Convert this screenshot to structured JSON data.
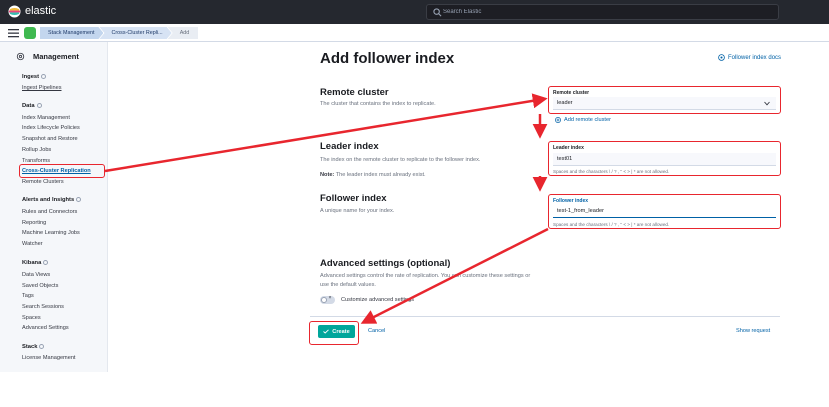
{
  "header": {
    "brand": "elastic",
    "search_placeholder": "Search Elastic"
  },
  "breadcrumbs": [
    "Stack Management",
    "Cross-Cluster Repli...",
    "Add"
  ],
  "sidebar": {
    "title": "Management",
    "groups": [
      {
        "label": "Ingest",
        "items": [
          "Ingest Pipelines"
        ]
      },
      {
        "label": "Data",
        "items": [
          "Index Management",
          "Index Lifecycle Policies",
          "Snapshot and Restore",
          "Rollup Jobs",
          "Transforms",
          "Cross-Cluster Replication",
          "Remote Clusters"
        ]
      },
      {
        "label": "Alerts and Insights",
        "items": [
          "Rules and Connectors",
          "Reporting",
          "Machine Learning Jobs",
          "Watcher"
        ]
      },
      {
        "label": "Kibana",
        "items": [
          "Data Views",
          "Saved Objects",
          "Tags",
          "Search Sessions",
          "Spaces",
          "Advanced Settings"
        ]
      },
      {
        "label": "Stack",
        "items": [
          "License Management"
        ]
      }
    ],
    "active_item": "Cross-Cluster Replication"
  },
  "main": {
    "title": "Add follower index",
    "docs_link": "Follower index docs",
    "remote_cluster": {
      "title": "Remote cluster",
      "description": "The cluster that contains the index to replicate.",
      "field_label": "Remote cluster",
      "value": "leader",
      "add_link": "Add remote cluster"
    },
    "leader_index": {
      "title": "Leader index",
      "description": "The index on the remote cluster to replicate to the follower index.",
      "note_label": "Note:",
      "note": "The leader index must already exist.",
      "field_label": "Leader index",
      "value": "test01",
      "help": "Spaces and the characters \\ / ? , \" < > | * are not allowed."
    },
    "follower_index": {
      "title": "Follower index",
      "description": "A unique name for your index.",
      "field_label": "Follower index",
      "value": "test-1_from_leader",
      "help": "Spaces and the characters \\ / ? , \" < > | * are not allowed."
    },
    "advanced": {
      "title": "Advanced settings (optional)",
      "description_line1": "Advanced settings control the rate of replication. You can customize these settings or",
      "description_line2": "use the default values.",
      "toggle_label": "Customize advanced settings"
    },
    "buttons": {
      "create": "Create",
      "cancel": "Cancel",
      "show_request": "Show request"
    }
  },
  "colors": {
    "annotation_red": "#e8262e",
    "primary_button": "#00a69b",
    "link_blue": "#0061a6",
    "header_bg": "#25282f"
  }
}
